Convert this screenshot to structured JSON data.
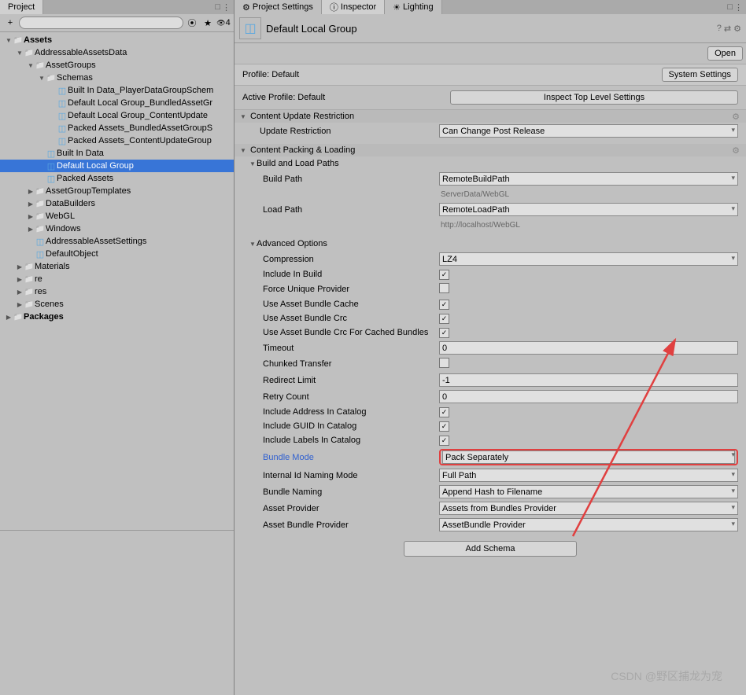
{
  "leftPanel": {
    "tab": "Project",
    "searchPlaceholder": "",
    "eyeCount": "4",
    "sectionHeader": "Assets",
    "tree": [
      {
        "depth": 0,
        "type": "folder",
        "expand": "down",
        "label": "Assets",
        "bold": true
      },
      {
        "depth": 1,
        "type": "folder",
        "expand": "down",
        "label": "AddressableAssetsData"
      },
      {
        "depth": 2,
        "type": "folder",
        "expand": "down",
        "label": "AssetGroups"
      },
      {
        "depth": 3,
        "type": "folder",
        "expand": "down",
        "label": "Schemas"
      },
      {
        "depth": 4,
        "type": "cube",
        "expand": "",
        "label": "Built In Data_PlayerDataGroupSchem"
      },
      {
        "depth": 4,
        "type": "cube",
        "expand": "",
        "label": "Default Local Group_BundledAssetGr"
      },
      {
        "depth": 4,
        "type": "cube",
        "expand": "",
        "label": "Default Local Group_ContentUpdate"
      },
      {
        "depth": 4,
        "type": "cube",
        "expand": "",
        "label": "Packed Assets_BundledAssetGroupS"
      },
      {
        "depth": 4,
        "type": "cube",
        "expand": "",
        "label": "Packed Assets_ContentUpdateGroup"
      },
      {
        "depth": 3,
        "type": "cube",
        "expand": "",
        "label": "Built In Data"
      },
      {
        "depth": 3,
        "type": "cube",
        "expand": "",
        "label": "Default Local Group",
        "selected": true
      },
      {
        "depth": 3,
        "type": "cube",
        "expand": "",
        "label": "Packed Assets"
      },
      {
        "depth": 2,
        "type": "folder",
        "expand": "right",
        "label": "AssetGroupTemplates"
      },
      {
        "depth": 2,
        "type": "folder",
        "expand": "right",
        "label": "DataBuilders"
      },
      {
        "depth": 2,
        "type": "folder",
        "expand": "right",
        "label": "WebGL"
      },
      {
        "depth": 2,
        "type": "folder",
        "expand": "right",
        "label": "Windows"
      },
      {
        "depth": 2,
        "type": "cube",
        "expand": "",
        "label": "AddressableAssetSettings"
      },
      {
        "depth": 2,
        "type": "cube",
        "expand": "",
        "label": "DefaultObject"
      },
      {
        "depth": 1,
        "type": "folder",
        "expand": "right",
        "label": "Materials"
      },
      {
        "depth": 1,
        "type": "folder",
        "expand": "right",
        "label": "re"
      },
      {
        "depth": 1,
        "type": "folder",
        "expand": "right",
        "label": "res"
      },
      {
        "depth": 1,
        "type": "folder",
        "expand": "right",
        "label": "Scenes"
      },
      {
        "depth": 0,
        "type": "folder",
        "expand": "right",
        "label": "Packages",
        "bold": true
      }
    ]
  },
  "rightPanel": {
    "tabs": [
      "Project Settings",
      "Inspector",
      "Lighting"
    ],
    "activeTab": 1,
    "title": "Default Local Group",
    "openBtn": "Open",
    "profileLabel": "Profile: Default",
    "systemSettingsBtn": "System Settings",
    "activeProfileLabel": "Active Profile: Default",
    "inspectTopBtn": "Inspect Top Level Settings",
    "sections": {
      "contentUpdate": {
        "title": "Content Update Restriction",
        "updateRestriction": {
          "label": "Update Restriction",
          "value": "Can Change Post Release"
        }
      },
      "contentPacking": {
        "title": "Content Packing & Loading",
        "buildLoadPaths": {
          "title": "Build and Load Paths",
          "buildPath": {
            "label": "Build Path",
            "value": "RemoteBuildPath",
            "path": "ServerData/WebGL"
          },
          "loadPath": {
            "label": "Load Path",
            "value": "RemoteLoadPath",
            "path": "http://localhost/WebGL"
          }
        },
        "advanced": {
          "title": "Advanced Options",
          "rows": [
            {
              "label": "Compression",
              "type": "select",
              "value": "LZ4"
            },
            {
              "label": "Include In Build",
              "type": "check",
              "value": true
            },
            {
              "label": "Force Unique Provider",
              "type": "check",
              "value": false
            },
            {
              "label": "Use Asset Bundle Cache",
              "type": "check",
              "value": true
            },
            {
              "label": "Use Asset Bundle Crc",
              "type": "check",
              "value": true
            },
            {
              "label": "Use Asset Bundle Crc For Cached Bundles",
              "type": "check",
              "value": true
            },
            {
              "label": "Timeout",
              "type": "text",
              "value": "0"
            },
            {
              "label": "Chunked Transfer",
              "type": "check",
              "value": false
            },
            {
              "label": "Redirect Limit",
              "type": "text",
              "value": "-1"
            },
            {
              "label": "Retry Count",
              "type": "text",
              "value": "0"
            },
            {
              "label": "Include Address In Catalog",
              "type": "check",
              "value": true
            },
            {
              "label": "Include GUID In Catalog",
              "type": "check",
              "value": true
            },
            {
              "label": "Include Labels In Catalog",
              "type": "check",
              "value": true
            },
            {
              "label": "Bundle Mode",
              "type": "select",
              "value": "Pack Separately",
              "highlight": true
            },
            {
              "label": "Internal Id Naming Mode",
              "type": "select",
              "value": "Full Path"
            },
            {
              "label": "Bundle Naming",
              "type": "select",
              "value": "Append Hash to Filename"
            },
            {
              "label": "Asset Provider",
              "type": "select",
              "value": "Assets from Bundles Provider"
            },
            {
              "label": "Asset Bundle Provider",
              "type": "select",
              "value": "AssetBundle Provider"
            }
          ]
        }
      }
    },
    "addSchemaBtn": "Add Schema"
  },
  "watermark": "CSDN @野区捕龙为宠"
}
